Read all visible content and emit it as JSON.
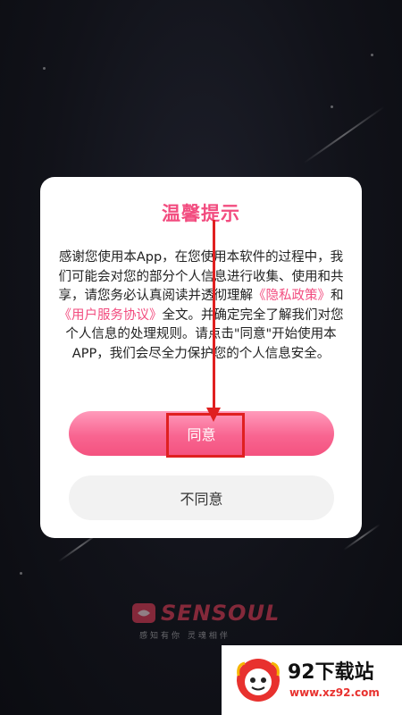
{
  "dialog": {
    "title": "温馨提示",
    "text_before": "感谢您使用本App，在您使用本软件的过程中，我们可能会对您的部分个人信息进行收集、使用和共享，请您务必认真阅读并透彻理解",
    "privacy_link": "《隐私政策》",
    "and": "和",
    "terms_link": "《用户服务协议》",
    "text_after": "全文。并确定完全了解我们对您个人信息的处理规则。请点击\"同意\"开始使用本APP，我们会尽全力保护您的个人信息安全。",
    "agree_label": "同意",
    "disagree_label": "不同意"
  },
  "background_brand": {
    "name": "SENSOUL",
    "tagline": "感知有你  灵魂相伴"
  },
  "watermark": {
    "title": "92下载站",
    "url": "www.xz92.com"
  },
  "colors": {
    "accent": "#f24c7f",
    "annotation": "#e02020",
    "brand": "#e23c56"
  }
}
